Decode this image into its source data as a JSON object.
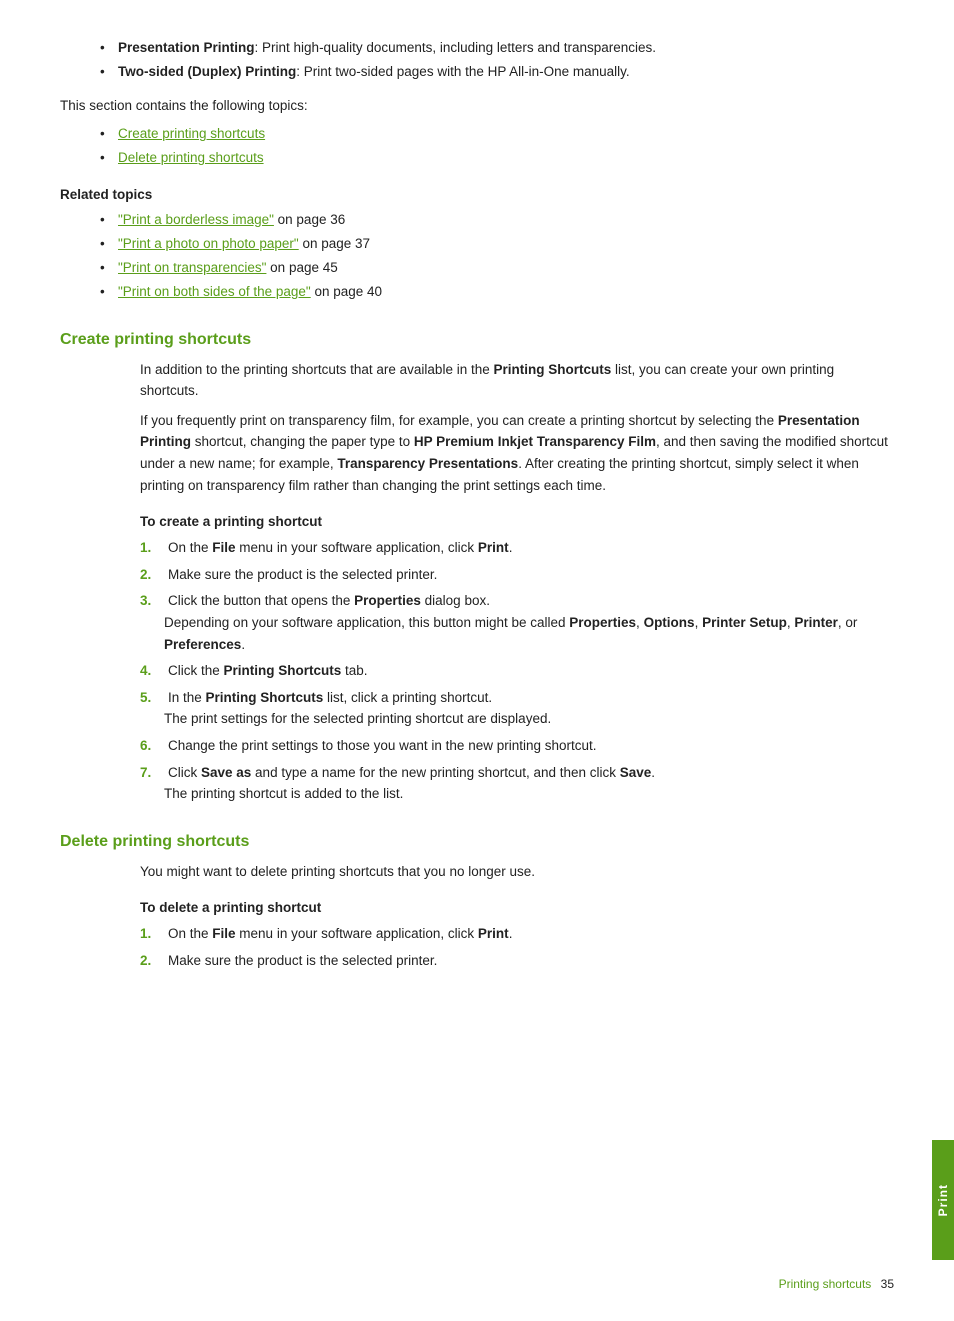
{
  "page": {
    "green_tab_label": "Print",
    "footer_section": "Printing shortcuts",
    "footer_page": "35"
  },
  "intro_bullets": [
    {
      "bold_part": "Presentation Printing",
      "rest": ": Print high-quality documents, including letters and transparencies."
    },
    {
      "bold_part": "Two-sided (Duplex) Printing",
      "rest": ": Print two-sided pages with the HP All-in-One manually."
    }
  ],
  "toc_intro": "This section contains the following topics:",
  "toc_links": [
    "Create printing shortcuts",
    "Delete printing shortcuts"
  ],
  "related_topics": {
    "heading": "Related topics",
    "items": [
      {
        "link": "\"Print a borderless image\"",
        "page": "on page 36"
      },
      {
        "link": "\"Print a photo on photo paper\"",
        "page": "on page 37"
      },
      {
        "link": "\"Print on transparencies\"",
        "page": "on page 45"
      },
      {
        "link": "\"Print on both sides of the page\"",
        "page": "on page 40"
      }
    ]
  },
  "create_section": {
    "heading": "Create printing shortcuts",
    "para1": "In addition to the printing shortcuts that are available in the ",
    "para1_bold": "Printing Shortcuts",
    "para1_end": " list, you can create your own printing shortcuts.",
    "para2_start": "If you frequently print on transparency film, for example, you can create a printing shortcut by selecting the ",
    "para2_b1": "Presentation Printing",
    "para2_mid1": " shortcut, changing the paper type to ",
    "para2_b2": "HP Premium Inkjet Transparency Film",
    "para2_mid2": ", and then saving the modified shortcut under a new name; for example, ",
    "para2_b3": "Transparency Presentations",
    "para2_end": ". After creating the printing shortcut, simply select it when printing on transparency film rather than changing the print settings each time.",
    "sub_heading": "To create a printing shortcut",
    "steps": [
      {
        "num": "1.",
        "text_start": "On the ",
        "bold1": "File",
        "text_mid": " menu in your software application, click ",
        "bold2": "Print",
        "text_end": "."
      },
      {
        "num": "2.",
        "text": "Make sure the product is the selected printer."
      },
      {
        "num": "3.",
        "text_start": "Click the button that opens the ",
        "bold1": "Properties",
        "text_mid": " dialog box.",
        "sub_text_start": "Depending on your software application, this button might be called ",
        "bold2": "Properties",
        "sub_mid1": ", ",
        "bold3": "Options",
        "sub_mid2": ", ",
        "bold4": "Printer Setup",
        "sub_mid3": ", ",
        "bold5": "Printer",
        "sub_mid4": ", or ",
        "bold6": "Preferences",
        "sub_end": "."
      },
      {
        "num": "4.",
        "text_start": "Click the ",
        "bold1": "Printing Shortcuts",
        "text_end": " tab."
      },
      {
        "num": "5.",
        "text_start": "In the ",
        "bold1": "Printing Shortcuts",
        "text_mid": " list, click a printing shortcut.",
        "sub_text": "The print settings for the selected printing shortcut are displayed."
      },
      {
        "num": "6.",
        "text": "Change the print settings to those you want in the new printing shortcut."
      },
      {
        "num": "7.",
        "text_start": "Click ",
        "bold1": "Save as",
        "text_mid": " and type a name for the new printing shortcut, and then click ",
        "bold2": "Save",
        "text_end": ".",
        "sub_text": "The printing shortcut is added to the list."
      }
    ]
  },
  "delete_section": {
    "heading": "Delete printing shortcuts",
    "para": "You might want to delete printing shortcuts that you no longer use.",
    "sub_heading": "To delete a printing shortcut",
    "steps": [
      {
        "num": "1.",
        "text_start": "On the ",
        "bold1": "File",
        "text_mid": " menu in your software application, click ",
        "bold2": "Print",
        "text_end": "."
      },
      {
        "num": "2.",
        "text": "Make sure the product is the selected printer."
      }
    ]
  }
}
